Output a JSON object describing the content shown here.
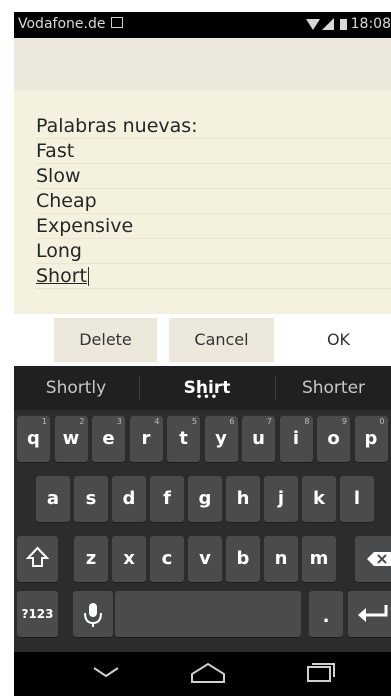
{
  "status_bar": {
    "carrier": "Vodafone.de",
    "time": "18:08"
  },
  "note": {
    "lines": [
      "Palabras nuevas:",
      "Fast",
      "Slow",
      "Cheap",
      "Expensive",
      "Long",
      "Short"
    ]
  },
  "dialog_buttons": {
    "delete": "Delete",
    "cancel": "Cancel",
    "ok": "OK"
  },
  "keyboard": {
    "suggestions": [
      "Shortly",
      "Shirt",
      "Shorter"
    ],
    "suggestion_more": "•••",
    "row1": [
      {
        "k": "q",
        "h": "1"
      },
      {
        "k": "w",
        "h": "2"
      },
      {
        "k": "e",
        "h": "3"
      },
      {
        "k": "r",
        "h": "4"
      },
      {
        "k": "t",
        "h": "5"
      },
      {
        "k": "y",
        "h": "6"
      },
      {
        "k": "u",
        "h": "7"
      },
      {
        "k": "i",
        "h": "8"
      },
      {
        "k": "o",
        "h": "9"
      },
      {
        "k": "p",
        "h": "0"
      }
    ],
    "row2": [
      "a",
      "s",
      "d",
      "f",
      "g",
      "h",
      "j",
      "k",
      "l"
    ],
    "row3": [
      "z",
      "x",
      "c",
      "v",
      "b",
      "n",
      "m"
    ],
    "symbols_key": "?123",
    "period_key": "."
  },
  "icons": {
    "shift": "shift-icon",
    "backspace": "backspace-icon",
    "microphone": "microphone-icon",
    "enter": "enter-icon",
    "nav_back": "back-icon",
    "nav_home": "home-icon",
    "nav_recents": "recents-icon"
  }
}
